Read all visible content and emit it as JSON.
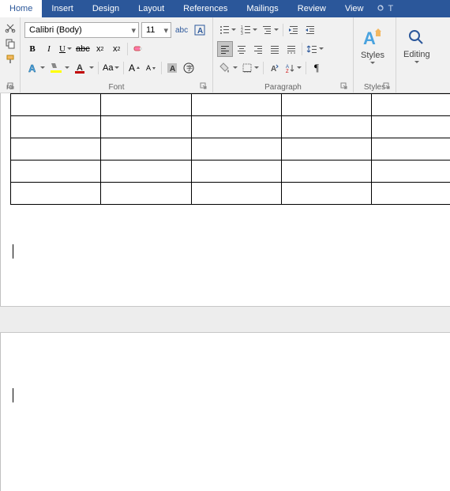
{
  "tabs": {
    "home": "Home",
    "insert": "Insert",
    "design": "Design",
    "layout": "Layout",
    "references": "References",
    "mailings": "Mailings",
    "review": "Review",
    "view": "View",
    "tellme": "T"
  },
  "font": {
    "name": "Calibri (Body)",
    "size": "11",
    "group_label": "Font"
  },
  "paragraph": {
    "group_label": "Paragraph"
  },
  "styles": {
    "label": "Styles",
    "group_label": "Styles"
  },
  "editing": {
    "label": "Editing"
  },
  "clipboard": {
    "label": "rd"
  }
}
